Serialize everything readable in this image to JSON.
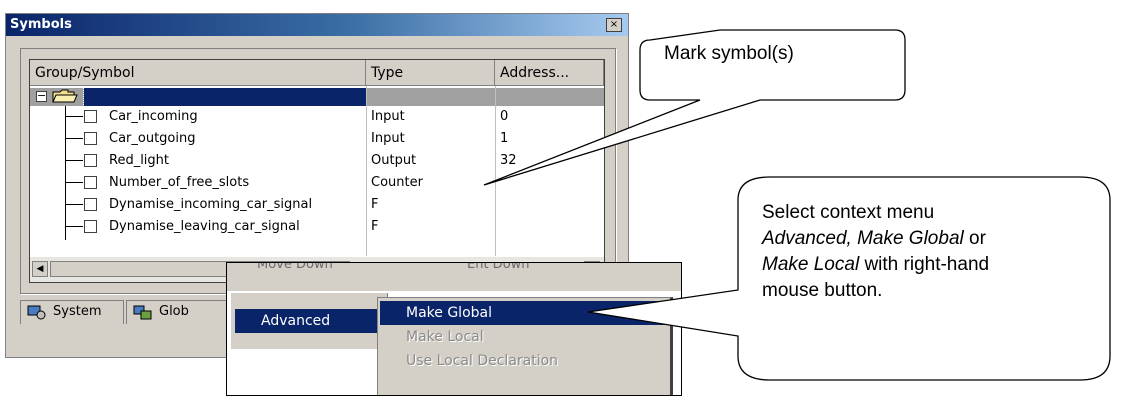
{
  "window": {
    "title": "Symbols",
    "close_glyph": "×"
  },
  "table": {
    "headers": [
      "Group/Symbol",
      "Type",
      "Address..."
    ],
    "rows": [
      {
        "symbol": "Car_incoming",
        "type": "Input",
        "address": "0"
      },
      {
        "symbol": "Car_outgoing",
        "type": "Input",
        "address": "1"
      },
      {
        "symbol": "Red_light",
        "type": "Output",
        "address": "32"
      },
      {
        "symbol": "Number_of_free_slots",
        "type": "Counter",
        "address": ""
      },
      {
        "symbol": "Dynamise_incoming_car_signal",
        "type": "F",
        "address": ""
      },
      {
        "symbol": "Dynamise_leaving_car_signal",
        "type": "F",
        "address": ""
      }
    ]
  },
  "tabs": [
    {
      "label": "System"
    },
    {
      "label": "Glob"
    }
  ],
  "context_menu": {
    "background_fragments": [
      "Move Down",
      "Ent Down"
    ],
    "parent_item": "Advanced",
    "submenu": [
      {
        "label": "Make Global",
        "enabled": true,
        "highlighted": true
      },
      {
        "label": "Make Local",
        "enabled": false
      },
      {
        "label": "Use Local Declaration",
        "enabled": false
      }
    ]
  },
  "callouts": {
    "mark": "Mark symbol(s)",
    "menu": {
      "line1": "Select context menu",
      "line2_italic": "Advanced, Make Global",
      "line2_tail": " or",
      "line3_italic": "Make Local",
      "line3_tail": " with right-hand",
      "line4": "mouse button."
    }
  },
  "colors": {
    "selection": "#0a246a",
    "face": "#d4d0c8"
  }
}
